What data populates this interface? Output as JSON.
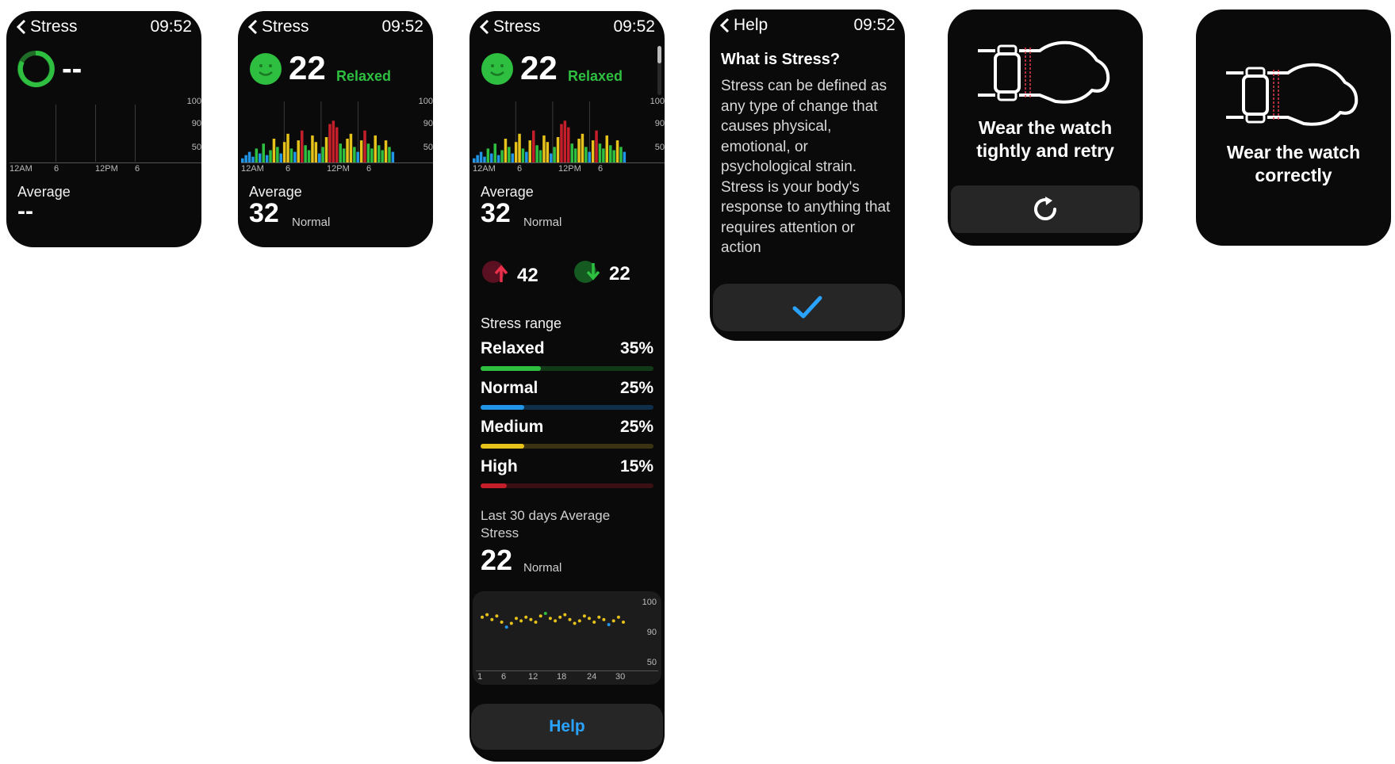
{
  "colors": {
    "relaxed": "#2fbf40",
    "normal": "#2196e8",
    "medium": "#e6c21a",
    "high": "#c41e2a",
    "help_blue": "#2aa3ff",
    "bg": "#0a0a0a"
  },
  "screen1": {
    "title": "Stress",
    "time": "09:52",
    "value": "--",
    "average_label": "Average",
    "average_value": "--",
    "y_ticks": [
      "100",
      "90",
      "50"
    ],
    "x_ticks": [
      "12AM",
      "6",
      "12PM",
      "6"
    ]
  },
  "screen2": {
    "title": "Stress",
    "time": "09:52",
    "value": "22",
    "status": "Relaxed",
    "average_label": "Average",
    "average_value": "32",
    "average_status": "Normal",
    "y_ticks": [
      "100",
      "90",
      "50"
    ],
    "x_ticks": [
      "12AM",
      "6",
      "12PM",
      "6"
    ]
  },
  "screen3": {
    "title": "Stress",
    "time": "09:52",
    "value": "22",
    "status": "Relaxed",
    "average_label": "Average",
    "average_value": "32",
    "average_status": "Normal",
    "max_value": "42",
    "min_value": "22",
    "range_title": "Stress range",
    "ranges": [
      {
        "label": "Relaxed",
        "pct": "35%",
        "fraction": 0.35
      },
      {
        "label": "Normal",
        "pct": "25%",
        "fraction": 0.25
      },
      {
        "label": "Medium",
        "pct": "25%",
        "fraction": 0.25
      },
      {
        "label": "High",
        "pct": "15%",
        "fraction": 0.15
      }
    ],
    "last30_label": "Last 30 days Average Stress",
    "last30_value": "22",
    "last30_status": "Normal",
    "y_ticks": [
      "100",
      "90",
      "50"
    ],
    "x_ticks": [
      "12AM",
      "6",
      "12PM",
      "6"
    ],
    "month_y_ticks": [
      "100",
      "90",
      "50"
    ],
    "month_x_ticks": [
      "1",
      "6",
      "12",
      "18",
      "24",
      "30"
    ],
    "help_label": "Help"
  },
  "screen4": {
    "title": "Help",
    "time": "09:52",
    "heading": "What is Stress?",
    "body": "Stress can be defined as any type of change that causes physical, emotional, or psychological strain. Stress is your body's response to anything that requires attention or action"
  },
  "screen5": {
    "message": "Wear the watch tightly and retry"
  },
  "screen6": {
    "message": "Wear the watch correctly"
  },
  "chart_data": [
    {
      "type": "bar",
      "title": "",
      "categories_note": "",
      "x_ticks": [
        "12AM",
        "6",
        "12PM",
        "6"
      ],
      "y_ticks": [
        100,
        90,
        50
      ],
      "values": [
        6,
        10,
        14,
        8,
        18,
        12,
        24,
        10,
        16,
        30,
        20,
        12,
        26,
        36,
        18,
        14,
        28,
        40,
        22,
        16,
        34,
        26,
        12,
        20,
        32,
        48,
        52,
        44,
        24,
        18,
        30,
        36,
        20,
        14,
        28,
        40,
        24,
        18,
        34,
        22,
        16,
        28,
        20,
        14
      ],
      "ylim": [
        0,
        100
      ]
    },
    {
      "type": "scatter",
      "title": "",
      "x": [
        1,
        2,
        3,
        4,
        5,
        6,
        7,
        8,
        9,
        10,
        11,
        12,
        13,
        14,
        15,
        16,
        17,
        18,
        19,
        20,
        21,
        22,
        23,
        24,
        25,
        26,
        27,
        28,
        29,
        30
      ],
      "values": [
        88,
        90,
        86,
        89,
        84,
        80,
        83,
        87,
        85,
        88,
        86,
        84,
        89,
        91,
        87,
        85,
        88,
        90,
        86,
        83,
        85,
        89,
        87,
        84,
        88,
        86,
        82,
        85,
        88,
        84
      ],
      "xlim": [
        1,
        30
      ],
      "ylim": [
        50,
        100
      ]
    }
  ]
}
